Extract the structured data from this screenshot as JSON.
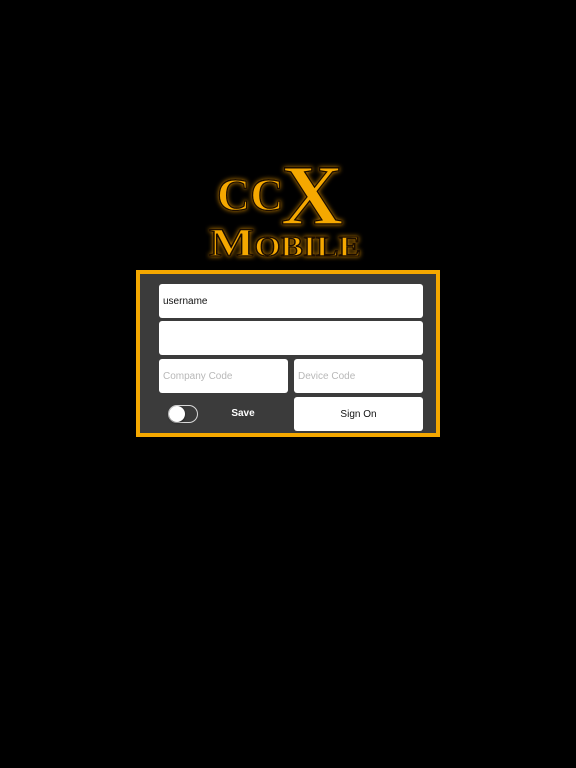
{
  "logo": {
    "line1_small": "CC",
    "line1_big": "X",
    "line2": "Mobile",
    "color": "#f5a800",
    "glow": "#d98c00"
  },
  "login": {
    "border_color": "#f5a800",
    "panel_color": "#3b3b3b",
    "username_value": "username",
    "password_value": "",
    "company_placeholder": "Company Code",
    "device_placeholder": "Device Code",
    "save_label": "Save",
    "save_toggle_on": false,
    "signon_label": "Sign On"
  }
}
